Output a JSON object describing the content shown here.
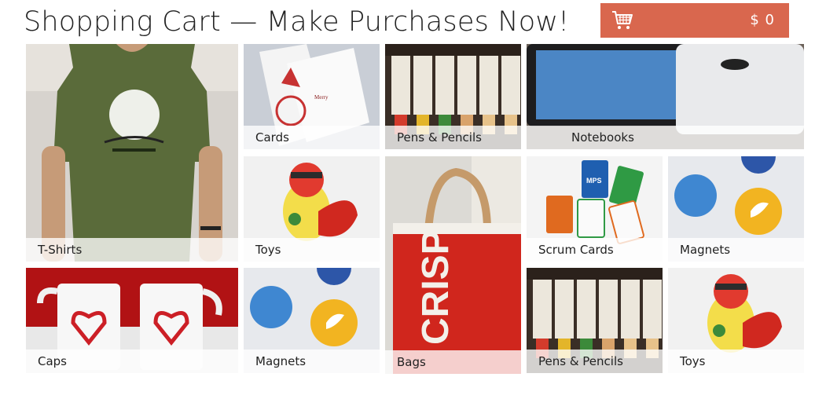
{
  "header": {
    "title": "Shopping Cart — Make Purchases Now!",
    "cart_total": "$ 0",
    "cart_icon": "shopping-cart-icon",
    "accent_color": "#d9674e"
  },
  "tiles": [
    {
      "label": "T-Shirts"
    },
    {
      "label": "Cards"
    },
    {
      "label": "Pens & Pencils"
    },
    {
      "label": "Notebooks"
    },
    {
      "label": "Toys"
    },
    {
      "label": "Bags"
    },
    {
      "label": "Scrum Cards"
    },
    {
      "label": "Magnets"
    },
    {
      "label": "Caps"
    },
    {
      "label": "Magnets"
    },
    {
      "label": "Pens & Pencils"
    },
    {
      "label": "Toys"
    }
  ],
  "images": {
    "bag_print": "CRISP",
    "card_print": "MPS"
  }
}
